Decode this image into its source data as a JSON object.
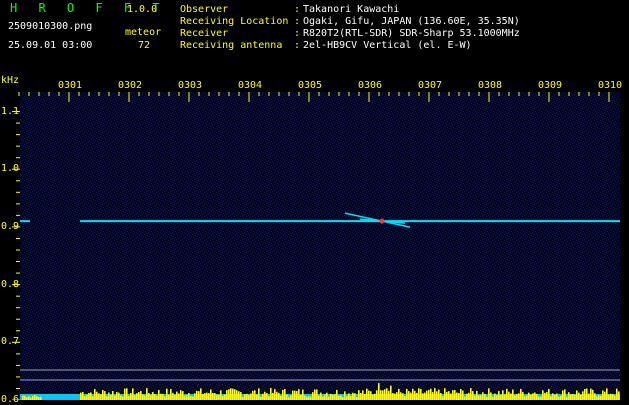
{
  "header": {
    "app_title": "H R O F F T",
    "version": "1.0.0",
    "file_name": "2509010300.png",
    "datetime": "25.09.01 03:00",
    "meteor_label": "meteor",
    "meteor_count": "72",
    "info": [
      {
        "label": "Observer",
        "value": "Takanori Kawachi"
      },
      {
        "label": "Receiving Location",
        "value": "Ogaki, Gifu, JAPAN (136.60E, 35.35N)"
      },
      {
        "label": "Receiver",
        "value": "R820T2(RTL-SDR) SDR-Sharp 53.1000MHz"
      },
      {
        "label": "Receiving antenna",
        "value": "2el-HB9CV Vertical (el. E-W)"
      }
    ],
    "colon": ":"
  },
  "chart_data": {
    "type": "heatmap",
    "y_unit": "kHz",
    "x_ticks": [
      "0301",
      "0302",
      "0303",
      "0304",
      "0305",
      "0306",
      "0307",
      "0308",
      "0309",
      "0310"
    ],
    "y_ticks": [
      "1.1",
      "1.0",
      "0.9",
      "0.8",
      "0.7",
      "0.6"
    ],
    "ylim": [
      0.6,
      1.12
    ],
    "carrier_khz": 0.91,
    "colors": {
      "background": "#000000",
      "noise": "#0c1670",
      "trace": "#00e0ff",
      "meteor": "#ff3333",
      "labels": "#ffff00",
      "text_green": "#00ff00",
      "text_white": "#ffffff",
      "activity_bar": "#ffff00",
      "activity_base": "#00c8ff"
    }
  }
}
